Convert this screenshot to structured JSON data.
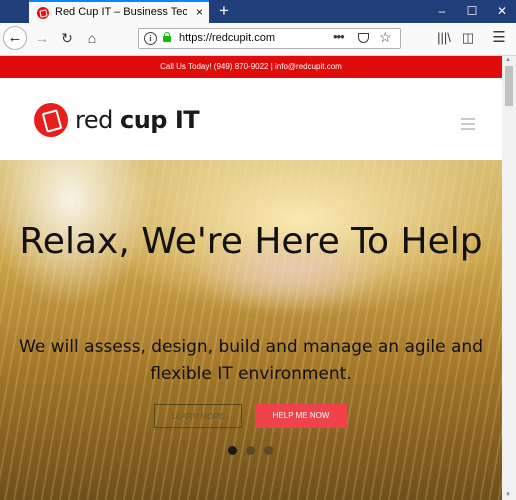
{
  "browser": {
    "tab_title": "Red Cup IT – Business Technolo",
    "tab_close": "×",
    "new_tab": "+",
    "url": "https://redcupit.com",
    "window_controls": [
      "–",
      "☐",
      "✕"
    ],
    "nav_icons": [
      "back-arrow-icon",
      "forward-arrow-icon",
      "reload-icon",
      "home-icon"
    ],
    "toolbar_icons": [
      "library-icon",
      "sidebar-icon",
      "menu-icon"
    ]
  },
  "site": {
    "top_bar": "Call Us Today! (949) 870-9022  |  info@redcupit.com",
    "logo": {
      "part1": "red ",
      "part2": "cup IT"
    },
    "hero": {
      "title": "Relax, We're Here To Help",
      "subtitle": "We will assess, design, build and manage an agile and flexible IT environment.",
      "learn_more": "LEARN MORE",
      "help_me_now": "HELP ME NOW"
    },
    "carousel": {
      "slides": 3,
      "active": 0
    }
  },
  "colors": {
    "brand_red": "#e00b0b",
    "cta": "#f0424a",
    "tab_accent": "#0a84ff"
  }
}
